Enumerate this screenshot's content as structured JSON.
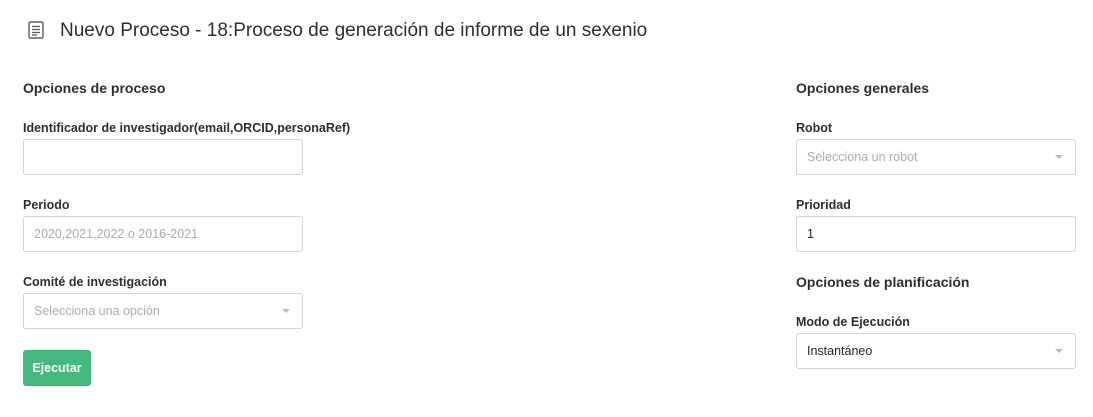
{
  "header": {
    "title": "Nuevo Proceso - 18:Proceso de generación de informe de un sexenio",
    "icon": "document-icon"
  },
  "process_options": {
    "section_title": "Opciones de proceso",
    "researcher_id": {
      "label": "Identificador de investigador(email,ORCID,personaRef)",
      "value": "",
      "placeholder": ""
    },
    "period": {
      "label": "Periodo",
      "value": "",
      "placeholder": "2020,2021,2022 o 2016-2021"
    },
    "committee": {
      "label": "Comité de investigación",
      "placeholder": "Selecciona una opción"
    },
    "execute_label": "Ejecutar"
  },
  "general_options": {
    "section_title": "Opciones generales",
    "robot": {
      "label": "Robot",
      "placeholder": "Selecciona un robot"
    },
    "priority": {
      "label": "Prioridad",
      "value": "1"
    }
  },
  "planning_options": {
    "section_title": "Opciones de planificación",
    "execution_mode": {
      "label": "Modo de Ejecución",
      "value": "Instantáneo"
    }
  },
  "colors": {
    "primary_button": "#45b97c",
    "border": "#ced4da",
    "placeholder": "#a8adb2"
  }
}
